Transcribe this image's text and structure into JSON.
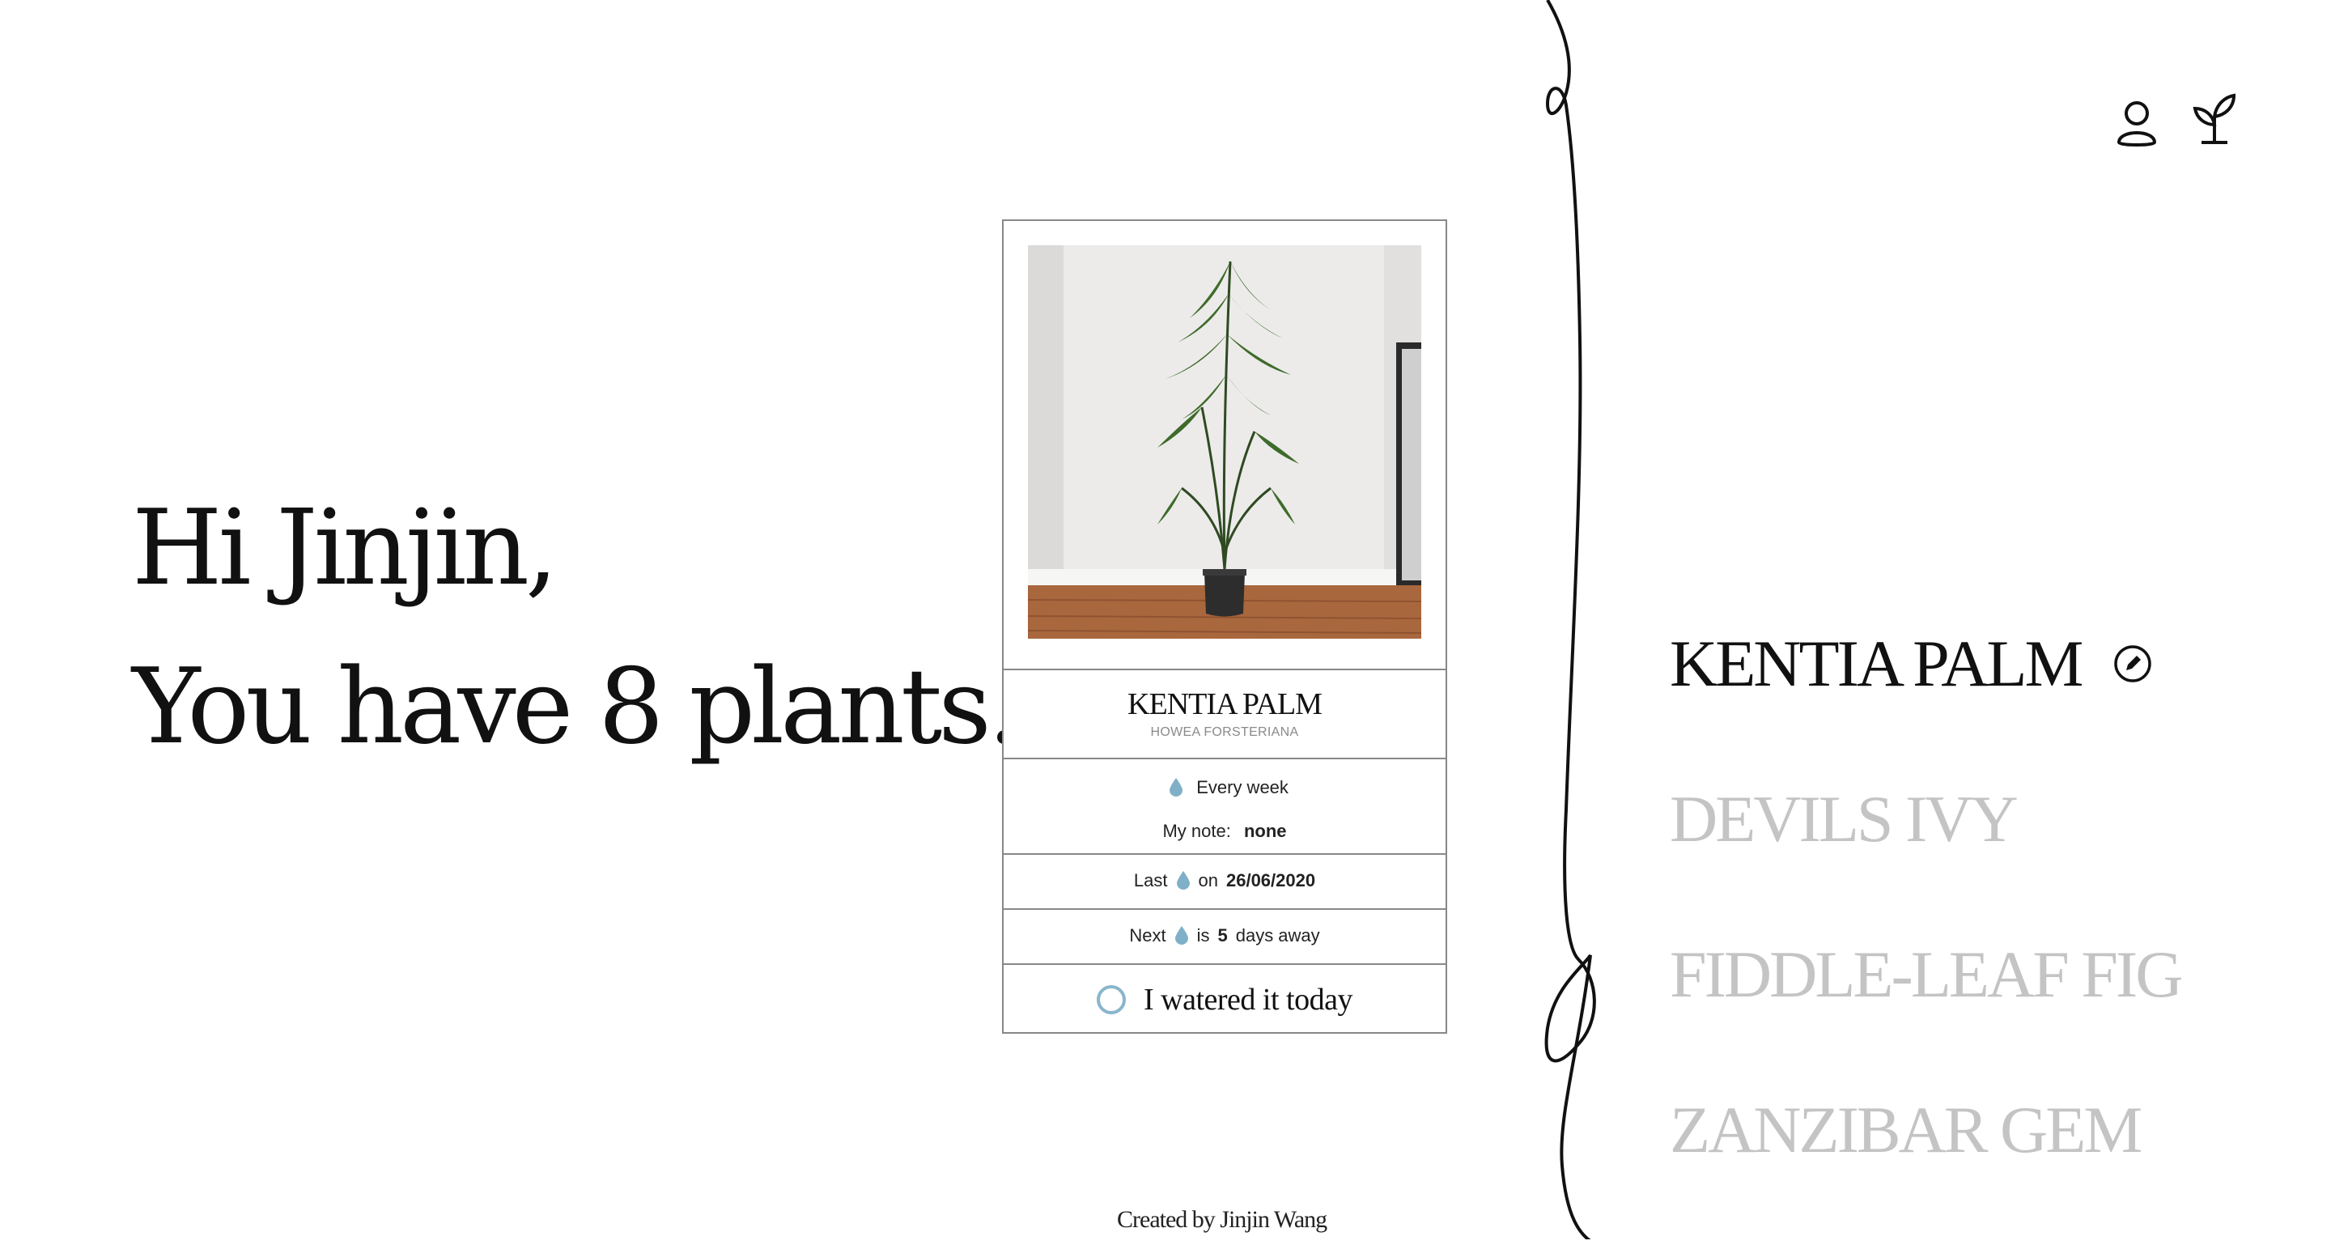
{
  "greeting": {
    "line1": "Hi Jinjin,",
    "line2": "You have 8 plants."
  },
  "card": {
    "name": "KENTIA PALM",
    "scientific_name": "HOWEA FORSTERIANA",
    "frequency": "Every week",
    "note_label": "My note:",
    "note_value": "none",
    "last_prefix": "Last",
    "last_mid": "on",
    "last_date": "26/06/2020",
    "next_prefix": "Next",
    "next_mid": "is",
    "next_days": "5",
    "next_suffix": "days away",
    "watered_label": "I watered it today",
    "watered_checked": false
  },
  "plants": [
    {
      "name": "KENTIA PALM",
      "active": true
    },
    {
      "name": "DEVILS IVY",
      "active": false
    },
    {
      "name": "FIDDLE-LEAF FIG",
      "active": false
    },
    {
      "name": "ZANZIBAR GEM",
      "active": false
    }
  ],
  "icons": {
    "user": "user-icon",
    "plant": "plant-sprout-icon",
    "edit": "pencil-edit-icon",
    "water": "water-drop-icon"
  },
  "colors": {
    "water_drop": "#7fb0c8",
    "muted_text": "#c4c4c4"
  },
  "footer": "Created by Jinjin Wang"
}
